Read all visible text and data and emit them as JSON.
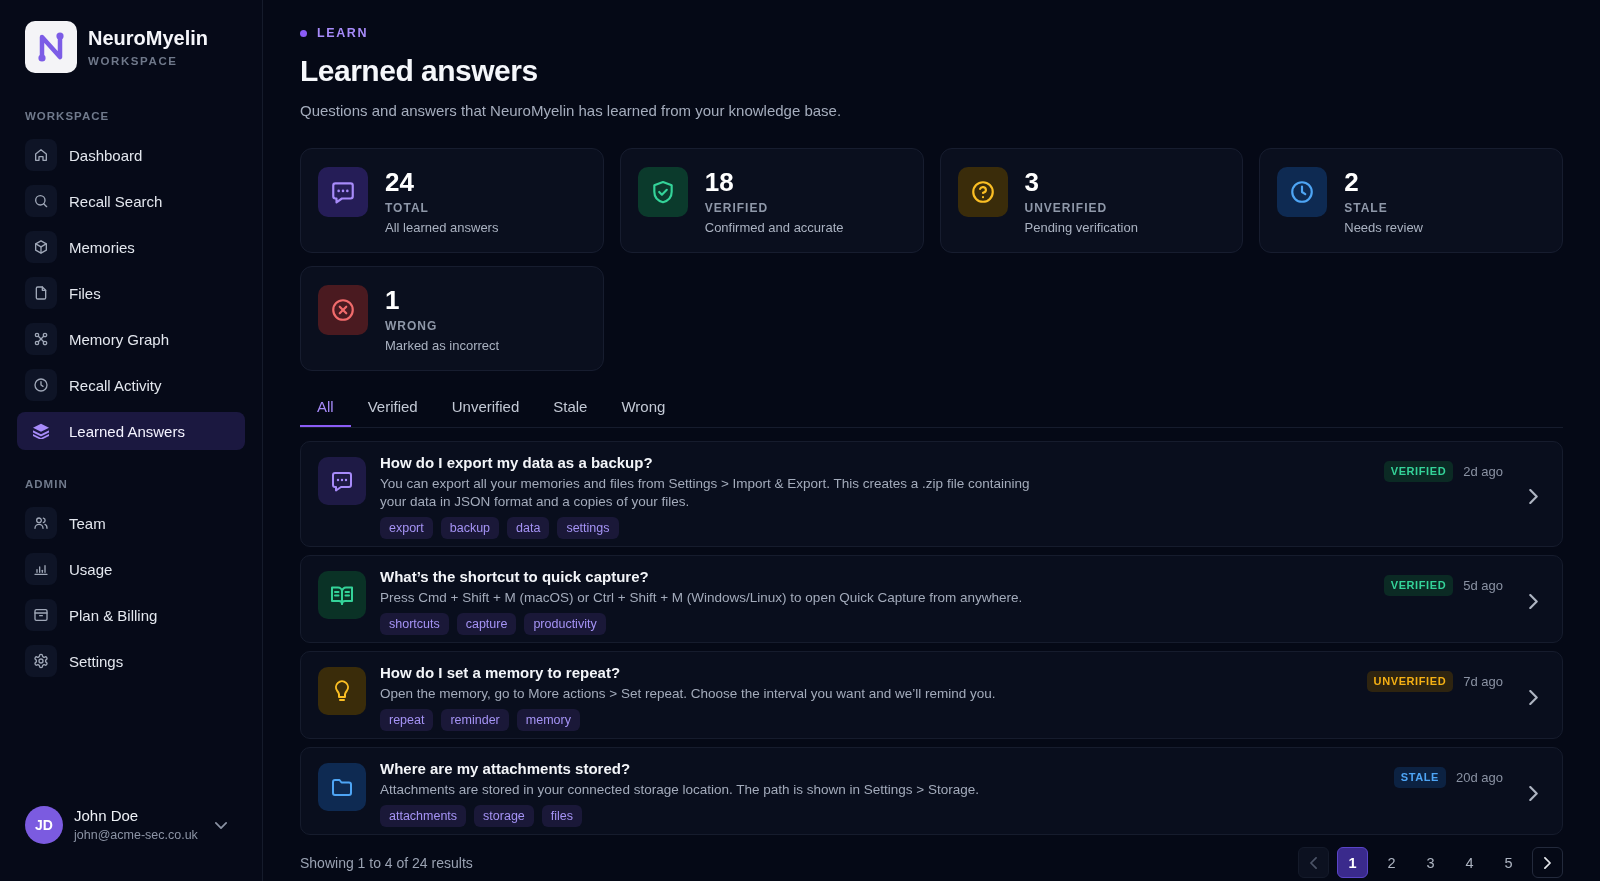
{
  "sidebar": {
    "brand": {
      "name": "NeuroMyelin",
      "subtitle": "WORKSPACE"
    },
    "sections": [
      {
        "title": "WORKSPACE",
        "items": [
          {
            "label": "Dashboard",
            "selected": false
          },
          {
            "label": "Recall Search",
            "selected": false
          },
          {
            "label": "Memories",
            "selected": false
          },
          {
            "label": "Files",
            "selected": false
          },
          {
            "label": "Memory Graph",
            "selected": false
          },
          {
            "label": "Recall Activity",
            "selected": false
          },
          {
            "label": "Learned Answers",
            "selected": true
          }
        ]
      },
      {
        "title": "ADMIN",
        "items": [
          {
            "label": "Team",
            "selected": false
          },
          {
            "label": "Usage",
            "selected": false
          },
          {
            "label": "Plan & Billing",
            "selected": false
          },
          {
            "label": "Settings",
            "selected": false
          }
        ]
      }
    ],
    "user": {
      "initials": "JD",
      "name": "John Doe",
      "email": "john@acme-sec.co.uk"
    }
  },
  "header": {
    "eyebrow": "LEARN",
    "title": "Learned answers",
    "subtitle": "Questions and answers that NeuroMyelin has learned from your knowledge base."
  },
  "stats": [
    {
      "kind": "total",
      "value": "24",
      "label": "TOTAL",
      "description": "All learned answers"
    },
    {
      "kind": "verified",
      "value": "18",
      "label": "VERIFIED",
      "description": "Confirmed and accurate"
    },
    {
      "kind": "unverified",
      "value": "3",
      "label": "UNVERIFIED",
      "description": "Pending verification"
    },
    {
      "kind": "stale",
      "value": "2",
      "label": "STALE",
      "description": "Needs review"
    },
    {
      "kind": "wrong",
      "value": "1",
      "label": "WRONG",
      "description": "Marked as incorrect"
    }
  ],
  "tabs": [
    {
      "label": "All",
      "selected": true
    },
    {
      "label": "Verified",
      "selected": false
    },
    {
      "label": "Unverified",
      "selected": false
    },
    {
      "label": "Stale",
      "selected": false
    },
    {
      "label": "Wrong",
      "selected": false
    }
  ],
  "answers": [
    {
      "question": "How do I export my data as a backup?",
      "answer": "You can export all your memories and files from Settings > Import & Export. This creates a .zip file containing your data in JSON format and a copies of your files.",
      "tags": [
        "export",
        "backup",
        "data",
        "settings"
      ],
      "status": {
        "kind": "verified",
        "label": "VERIFIED"
      },
      "time": "2d ago"
    },
    {
      "question": "What’s the shortcut to quick capture?",
      "answer": "Press Cmd + Shift + M (macOS) or Ctrl + Shift + M (Windows/Linux) to open Quick Capture from anywhere.",
      "tags": [
        "shortcuts",
        "capture",
        "productivity"
      ],
      "status": {
        "kind": "verified",
        "label": "VERIFIED"
      },
      "time": "5d ago"
    },
    {
      "question": "How do I set a memory to repeat?",
      "answer": "Open the memory, go to More actions > Set repeat. Choose the interval you want and we’ll remind you.",
      "tags": [
        "repeat",
        "reminder",
        "memory"
      ],
      "status": {
        "kind": "unverified",
        "label": "UNVERIFIED"
      },
      "time": "7d ago"
    },
    {
      "question": "Where are my attachments stored?",
      "answer": "Attachments are stored in your connected storage location. The path is shown in Settings > Storage.",
      "tags": [
        "attachments",
        "storage",
        "files"
      ],
      "status": {
        "kind": "stale",
        "label": "STALE"
      },
      "time": "20d ago"
    }
  ],
  "pagination": {
    "summary": "Showing 1 to 4 of 24 results",
    "previous": {
      "disabled": true
    },
    "pages": [
      {
        "label": "1",
        "selected": true
      },
      {
        "label": "2",
        "selected": false
      },
      {
        "label": "3",
        "selected": false
      },
      {
        "label": "4",
        "selected": false
      },
      {
        "label": "5",
        "selected": false
      }
    ],
    "next": {
      "disabled": false
    }
  }
}
